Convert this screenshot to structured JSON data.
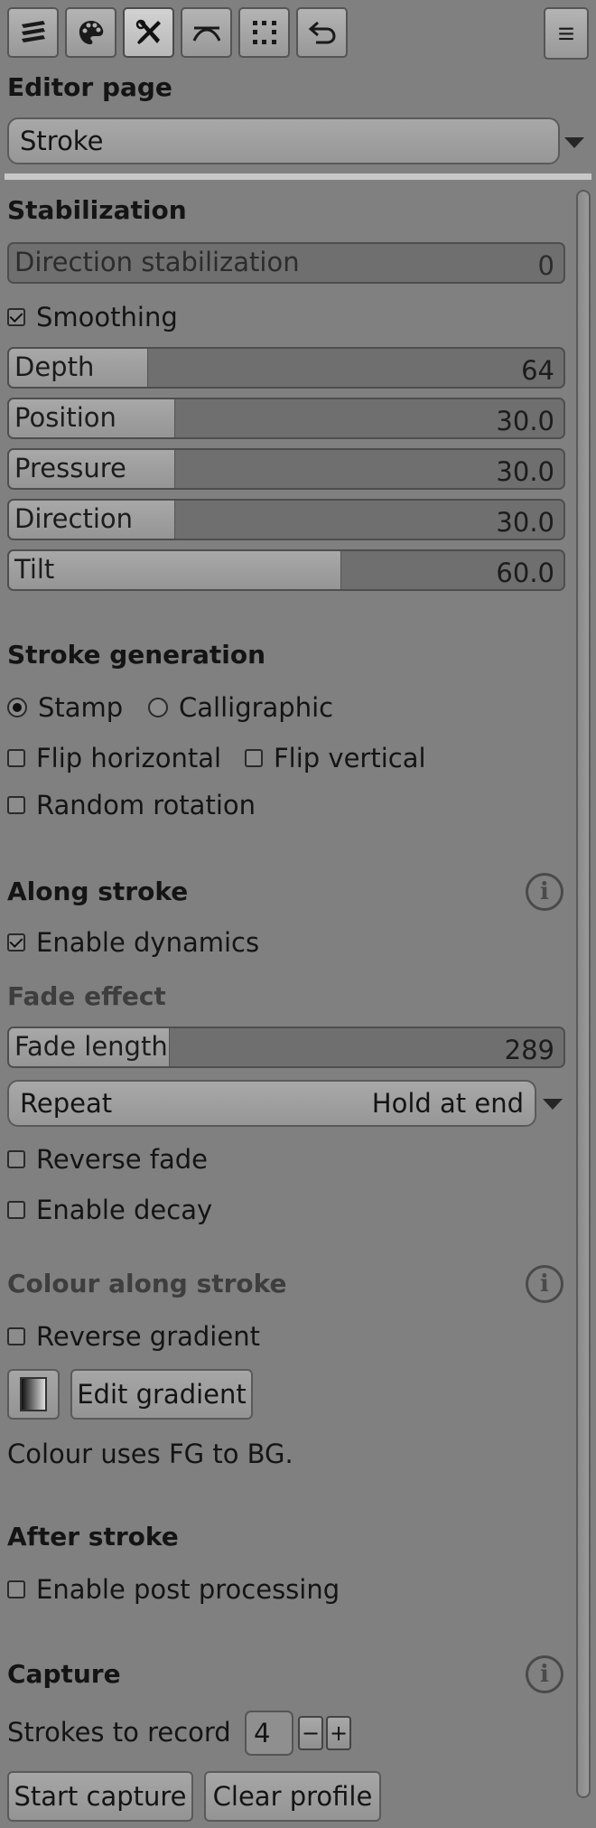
{
  "toolbar": {
    "tools": [
      {
        "icon": "layers-icon"
      },
      {
        "icon": "palette-icon"
      },
      {
        "icon": "tools-icon",
        "active": true
      },
      {
        "icon": "stroke-curve-icon"
      },
      {
        "icon": "selection-icon"
      },
      {
        "icon": "undo-history-icon"
      }
    ],
    "menu_icon": "menu-icon"
  },
  "editor": {
    "title": "Editor page",
    "page_value": "Stroke"
  },
  "stabilization": {
    "title": "Stabilization",
    "direction_label": "Direction stabilization",
    "direction_value": "0",
    "smoothing_label": "Smoothing",
    "smoothing_checked": true,
    "sliders": [
      {
        "label": "Depth",
        "value": "64",
        "fraction": 0.25
      },
      {
        "label": "Position",
        "value": "30.0",
        "fraction": 0.3
      },
      {
        "label": "Pressure",
        "value": "30.0",
        "fraction": 0.3
      },
      {
        "label": "Direction",
        "value": "30.0",
        "fraction": 0.3
      },
      {
        "label": "Tilt",
        "value": "60.0",
        "fraction": 0.6
      }
    ]
  },
  "generation": {
    "title": "Stroke generation",
    "stamp_label": "Stamp",
    "calligraphic_label": "Calligraphic",
    "flip_h_label": "Flip horizontal",
    "flip_v_label": "Flip vertical",
    "random_rotation_label": "Random rotation"
  },
  "along": {
    "title": "Along stroke",
    "enable_dynamics_label": "Enable dynamics",
    "fade_title": "Fade effect",
    "fade_length_label": "Fade length",
    "fade_length_value": "289",
    "fade_fraction": 0.29,
    "repeat_label": "Repeat",
    "repeat_value": "Hold at end",
    "reverse_fade_label": "Reverse fade",
    "enable_decay_label": "Enable decay"
  },
  "colour": {
    "title": "Colour along stroke",
    "reverse_gradient_label": "Reverse gradient",
    "edit_gradient_label": "Edit gradient",
    "note": "Colour uses FG to BG."
  },
  "after": {
    "title": "After stroke",
    "post_processing_label": "Enable post processing"
  },
  "capture": {
    "title": "Capture",
    "strokes_label": "Strokes to record",
    "strokes_value": "4",
    "minus": "−",
    "plus": "+",
    "start_label": "Start capture",
    "clear_label": "Clear profile"
  }
}
